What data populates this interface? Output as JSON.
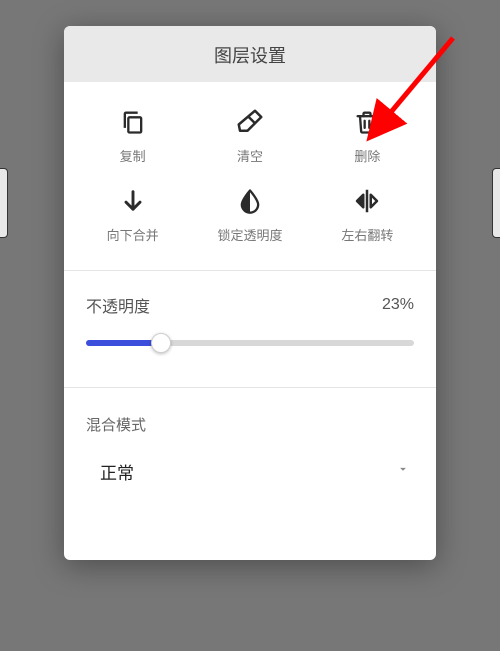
{
  "header": {
    "title": "图层设置"
  },
  "actions": {
    "copy": {
      "label": "复制"
    },
    "clear": {
      "label": "清空"
    },
    "delete": {
      "label": "删除"
    },
    "mergeDown": {
      "label": "向下合并"
    },
    "lockAlpha": {
      "label": "锁定透明度"
    },
    "flipH": {
      "label": "左右翻转"
    }
  },
  "opacity": {
    "label": "不透明度",
    "value": 23,
    "display": "23%"
  },
  "blend": {
    "label": "混合模式",
    "value": "正常"
  }
}
